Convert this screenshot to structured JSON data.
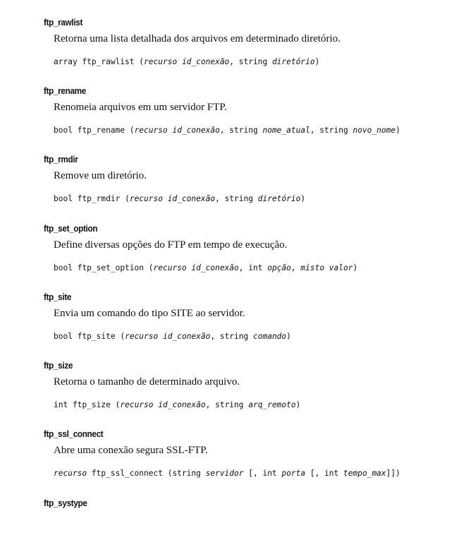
{
  "entries": [
    {
      "name": "ftp_rawlist",
      "description": "Retorna uma lista detalhada dos arquivos em determinado diretório.",
      "signature": {
        "ret": "array",
        "fn": "ftp_rawlist",
        "open": "(",
        "p1_type": "recurso",
        "p1_name": "id_conexão",
        "sep1": ", string",
        "p2_name": "diretório",
        "close": ")"
      }
    },
    {
      "name": "ftp_rename",
      "description": "Renomeia arquivos em um servidor FTP.",
      "signature": {
        "ret": "bool",
        "fn": "ftp_rename",
        "open": "(",
        "p1_type": "recurso",
        "p1_name": "id_conexão",
        "sep1": ", string",
        "p2_name": "nome_atual",
        "sep2": ", string",
        "p3_name": "novo_nome",
        "close": ")"
      }
    },
    {
      "name": "ftp_rmdir",
      "description": "Remove um diretório.",
      "signature": {
        "ret": "bool",
        "fn": "ftp_rmdir",
        "open": "(",
        "p1_type": "recurso",
        "p1_name": "id_conexão",
        "sep1": ", string",
        "p2_name": "diretório",
        "close": ")"
      }
    },
    {
      "name": "ftp_set_option",
      "description": "Define diversas opções do FTP em tempo de execução.",
      "signature": {
        "ret": "bool",
        "fn": "ftp_set_option",
        "open": "(",
        "p1_type": "recurso",
        "p1_name": "id_conexão",
        "sep1": ", int",
        "p2_name": "opção",
        "sep2": ",",
        "p3_name": "misto valor",
        "close": ")"
      }
    },
    {
      "name": "ftp_site",
      "description": "Envia um comando do tipo SITE ao servidor.",
      "signature": {
        "ret": "bool",
        "fn": "ftp_site",
        "open": "(",
        "p1_type": "recurso",
        "p1_name": "id_conexão",
        "sep1": ", string",
        "p2_name": "comando",
        "close": ")"
      }
    },
    {
      "name": "ftp_size",
      "description": "Retorna o tamanho de determinado arquivo.",
      "signature": {
        "ret": "int",
        "fn": "ftp_size",
        "open": "(",
        "p1_type": "recurso",
        "p1_name": "id_conexão",
        "sep1": ", string",
        "p2_name": "arq_remoto",
        "close": ")"
      }
    },
    {
      "name": "ftp_ssl_connect",
      "description": "Abre uma conexão segura SSL-FTP.",
      "signature": {
        "ret": "recurso",
        "fn": "ftp_ssl_connect",
        "open": "(string",
        "p1_name": "servidor",
        "sep1": "[, int",
        "p2_name": "porta",
        "sep2": "[, int",
        "p3_name": "tempo_max",
        "close": "]])"
      }
    },
    {
      "name": "ftp_systype"
    }
  ]
}
